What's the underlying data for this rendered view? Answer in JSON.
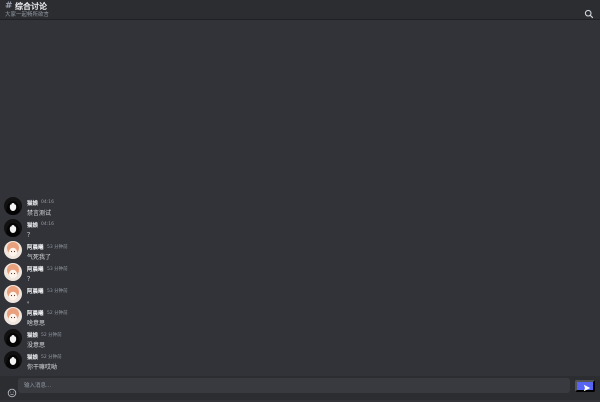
{
  "channel": {
    "title": "综合讨论",
    "subtitle": "大家一起畅所欲言"
  },
  "messages": [
    {
      "author": "猫娘",
      "time": "04:16",
      "text": "禁言测试",
      "avatar": "catgirl"
    },
    {
      "author": "猫娘",
      "time": "04:16",
      "text": "？",
      "avatar": "catgirl"
    },
    {
      "author": "阿晨曦",
      "time": "53 分钟前",
      "text": "气死我了",
      "avatar": "anime-girl"
    },
    {
      "author": "阿晨曦",
      "time": "53 分钟前",
      "text": "？",
      "avatar": "anime-girl"
    },
    {
      "author": "阿晨曦",
      "time": "53 分钟前",
      "text": "。",
      "avatar": "anime-girl"
    },
    {
      "author": "阿晨曦",
      "time": "52 分钟前",
      "text": "啥意思",
      "avatar": "anime-girl"
    },
    {
      "author": "猫娘",
      "time": "52 分钟前",
      "text": "没意思",
      "avatar": "catgirl"
    },
    {
      "author": "猫娘",
      "time": "52 分钟前",
      "text": "你干嘛哎呦",
      "avatar": "catgirl"
    }
  ],
  "composer": {
    "placeholder": "输入消息..."
  },
  "icons": {
    "search": "search-icon",
    "emoji": "emoji-icon",
    "send": "send-icon"
  },
  "colors": {
    "background": "#313338",
    "header": "#2b2d31",
    "accent": "#5865f2"
  }
}
